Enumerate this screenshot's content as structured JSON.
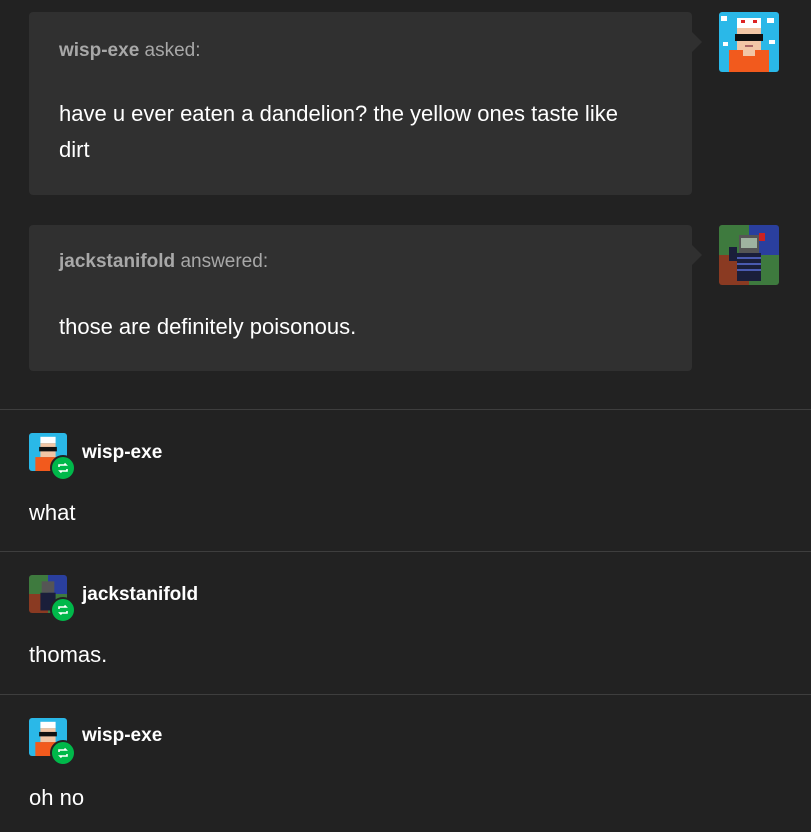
{
  "ask1": {
    "username": "wisp-exe",
    "verb": "asked:",
    "body": "have u ever eaten a dandelion? the yellow ones taste like dirt"
  },
  "ask2": {
    "username": "jackstanifold",
    "verb": "answered:",
    "body": "those are definitely poisonous."
  },
  "replies": [
    {
      "username": "wisp-exe",
      "text": "what"
    },
    {
      "username": "jackstanifold",
      "text": "thomas."
    },
    {
      "username": "wisp-exe",
      "text": "oh no"
    }
  ],
  "colors": {
    "background": "#222222",
    "bubble": "#303030",
    "reblog_badge": "#00b84a"
  },
  "icons": {
    "reblog": "reblog-icon"
  }
}
